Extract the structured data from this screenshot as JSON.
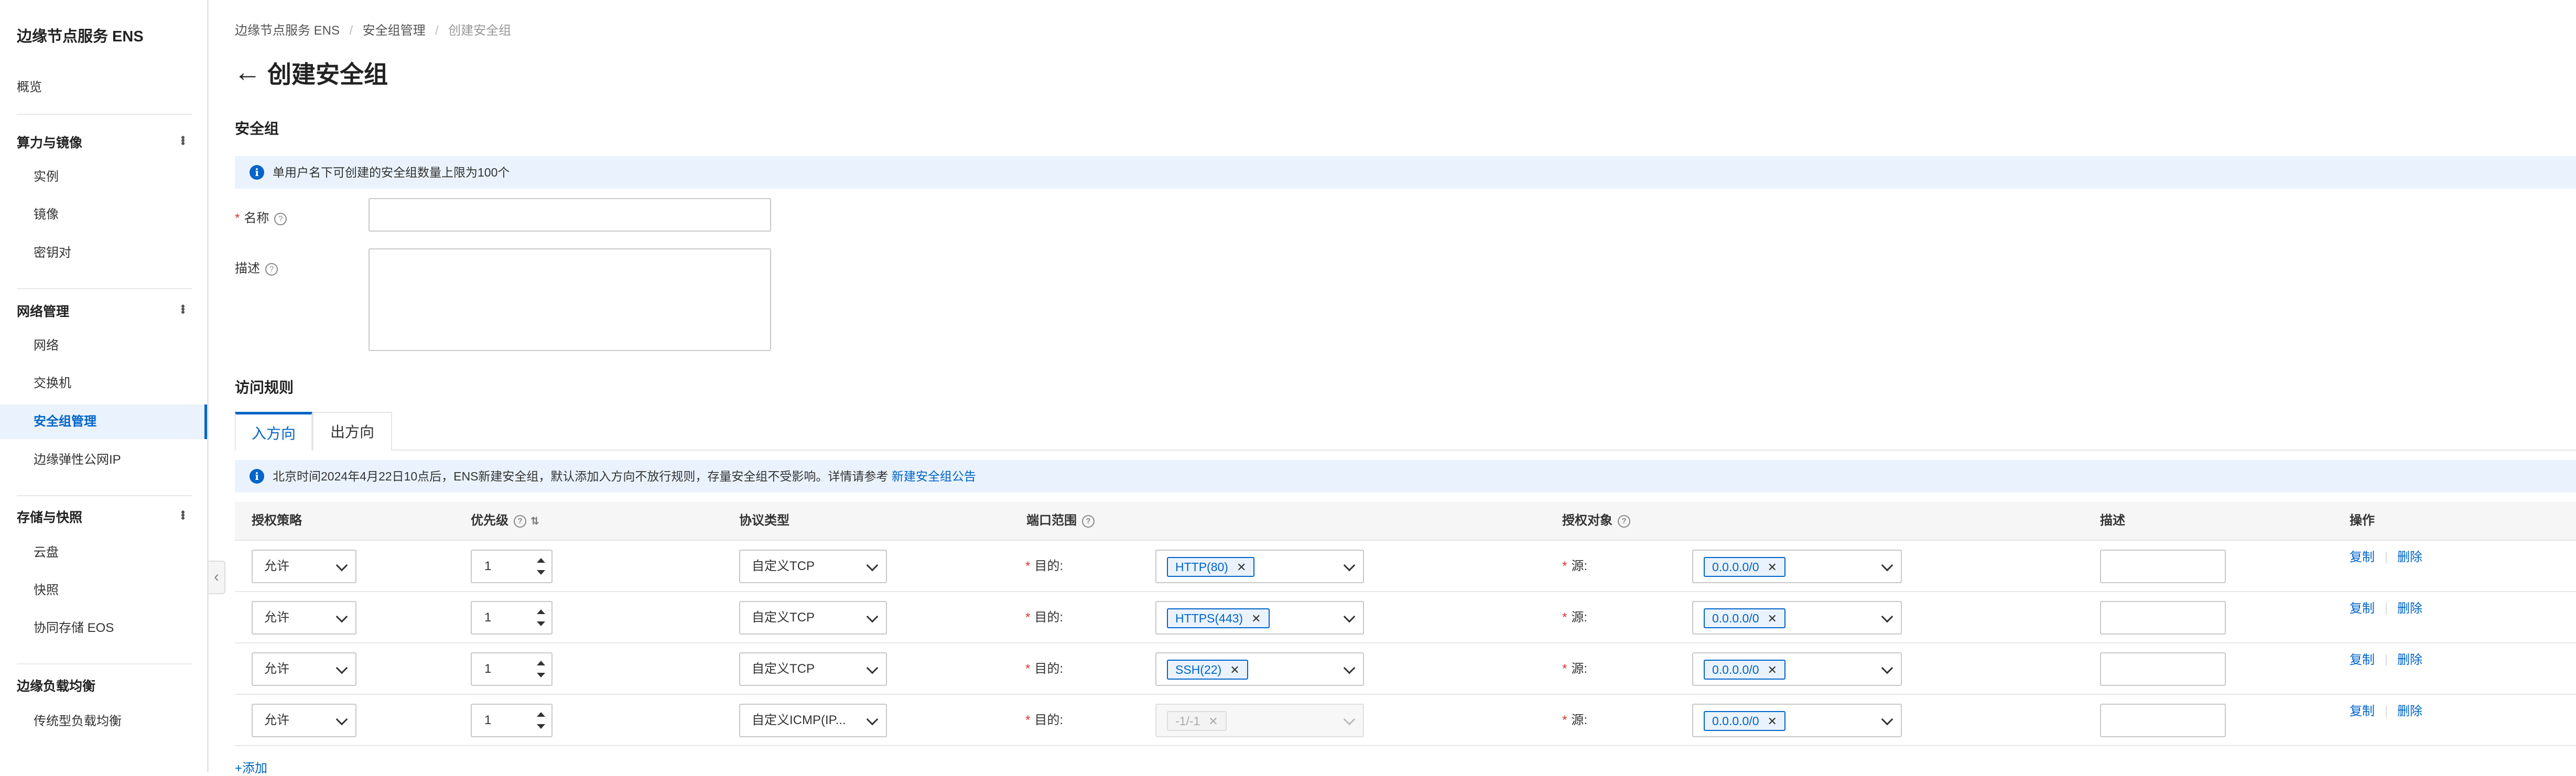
{
  "sidebar": {
    "title": "边缘节点服务 ENS",
    "overview": "概览",
    "groups": [
      {
        "label": "算力与镜像",
        "items": [
          "实例",
          "镜像",
          "密钥对"
        ]
      },
      {
        "label": "网络管理",
        "items": [
          "网络",
          "交换机",
          "安全组管理",
          "边缘弹性公网IP"
        ]
      },
      {
        "label": "存储与快照",
        "items": [
          "云盘",
          "快照",
          "协同存储 EOS"
        ]
      },
      {
        "label": "边缘负载均衡",
        "items": [
          "传统型负载均衡"
        ]
      }
    ],
    "active_item": "安全组管理"
  },
  "breadcrumb": [
    "边缘节点服务 ENS",
    "安全组管理",
    "创建安全组"
  ],
  "page_title": "创建安全组",
  "security_group": {
    "section_title": "安全组",
    "notice": "单用户名下可创建的安全组数量上限为100个",
    "name_label": "名称",
    "name_value": "",
    "desc_label": "描述",
    "desc_value": ""
  },
  "access_rules": {
    "section_title": "访问规则",
    "tabs": [
      "入方向",
      "出方向"
    ],
    "active_tab": "入方向",
    "notice_text": "北京时间2024年4月22日10点后，ENS新建安全组，默认添加入方向不放行规则，存量安全组不受影响。详情请参考",
    "notice_link": "新建安全组公告",
    "columns": [
      "授权策略",
      "优先级",
      "协议类型",
      "端口范围",
      "授权对象",
      "描述",
      "操作"
    ],
    "dest_label": "目的:",
    "src_label": "源:",
    "rows": [
      {
        "policy": "允许",
        "priority": "1",
        "protocol": "自定义TCP",
        "port": "HTTP(80)",
        "port_disabled": false,
        "source": "0.0.0.0/0",
        "description": "",
        "copy": "复制",
        "delete": "删除"
      },
      {
        "policy": "允许",
        "priority": "1",
        "protocol": "自定义TCP",
        "port": "HTTPS(443)",
        "port_disabled": false,
        "source": "0.0.0.0/0",
        "description": "",
        "copy": "复制",
        "delete": "删除"
      },
      {
        "policy": "允许",
        "priority": "1",
        "protocol": "自定义TCP",
        "port": "SSH(22)",
        "port_disabled": false,
        "source": "0.0.0.0/0",
        "description": "",
        "copy": "复制",
        "delete": "删除"
      },
      {
        "policy": "允许",
        "priority": "1",
        "protocol": "自定义ICMP(IP...",
        "port": "-1/-1",
        "port_disabled": true,
        "source": "0.0.0.0/0",
        "description": "",
        "copy": "复制",
        "delete": "删除"
      }
    ],
    "add_label": "+添加"
  },
  "colors": {
    "accent": "#0064c8",
    "notice_bg": "#eaf3fd",
    "required": "#e0332e"
  }
}
